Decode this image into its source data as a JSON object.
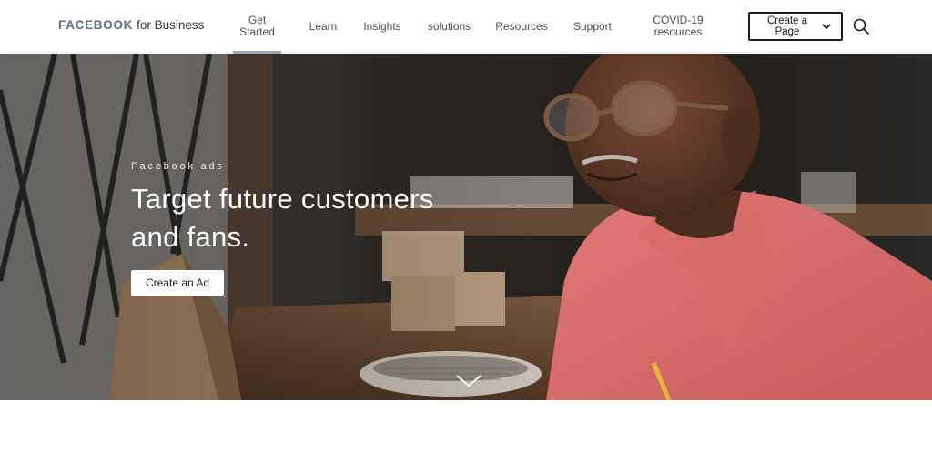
{
  "brand": {
    "name": "FACEBOOK",
    "suffix": "for Business"
  },
  "nav": {
    "items": [
      {
        "label": "Get Started",
        "active": true
      },
      {
        "label": "Learn"
      },
      {
        "label": "Insights"
      },
      {
        "label": "solutions"
      },
      {
        "label": "Resources"
      },
      {
        "label": "Support"
      },
      {
        "label": "COVID-19 resources"
      }
    ],
    "create_page_label": "Create a Page",
    "create_page_icon": "chevron-down-icon",
    "search_icon": "search-icon"
  },
  "hero": {
    "eyebrow": "Facebook ads",
    "headline": "Target future customers and fans.",
    "cta_label": "Create an Ad",
    "scroll_icon": "chevron-down-icon",
    "image_subject": "smiling man with glasses in pink shirt"
  },
  "colors": {
    "brand_text": "#5d6b84",
    "active_underline": "#9aa6b8",
    "button_border": "#1c1e21"
  }
}
